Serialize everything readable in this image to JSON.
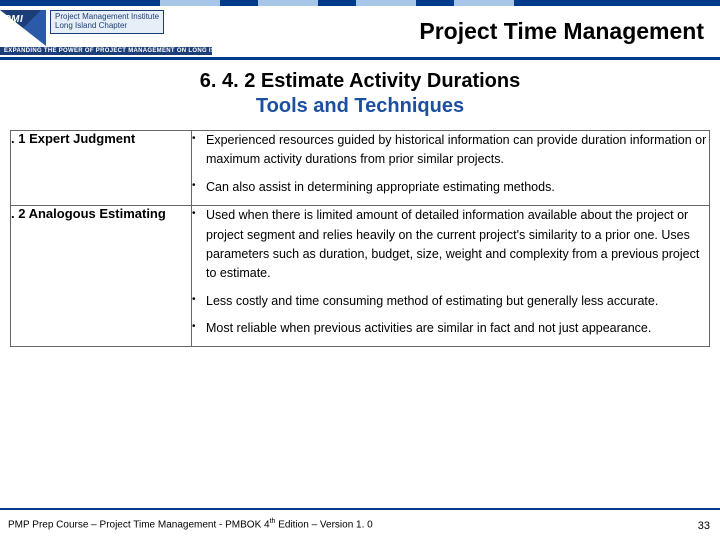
{
  "header": {
    "logo_label": "Project Management Institute\nLong Island Chapter",
    "logo_sublabel": "EXPANDING THE POWER OF PROJECT MANAGEMENT ON LONG ISLAND",
    "title": "Project Time Management"
  },
  "section": {
    "line1": "6. 4. 2 Estimate Activity Durations",
    "line2": "Tools and Techniques"
  },
  "rows": [
    {
      "label": ". 1  Expert Judgment",
      "bullets": [
        "Experienced resources guided by  historical information can provide duration information or maximum activity durations from prior similar projects.",
        "Can also assist in determining appropriate estimating methods."
      ]
    },
    {
      "label": ". 2 Analogous Estimating",
      "bullets": [
        "Used when there is limited amount of detailed information available about the project or project segment and relies heavily on the current project's similarity to a prior one. Uses parameters such as duration, budget, size, weight and complexity from a previous project to estimate.",
        "Less costly and time consuming method of estimating but generally less accurate.",
        "Most reliable when previous activities are similar in fact and not just appearance."
      ]
    }
  ],
  "footer": {
    "text_pre": "PMP Prep Course – Project Time Management - PMBOK 4",
    "text_sup": "th",
    "text_post": " Edition – Version 1. 0",
    "page": "33"
  }
}
